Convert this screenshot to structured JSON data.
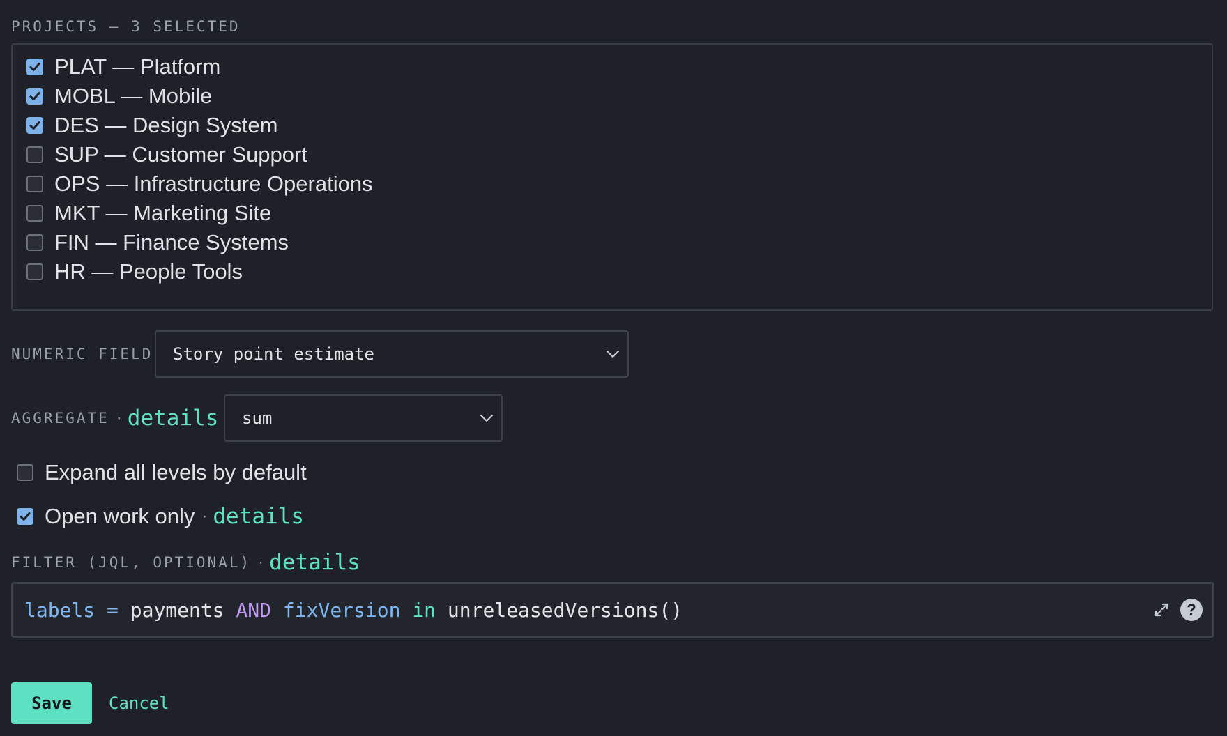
{
  "projects": {
    "label": "PROJECTS — 3 SELECTED",
    "items": [
      {
        "label": "PLAT — Platform",
        "checked": true
      },
      {
        "label": "MOBL — Mobile",
        "checked": true
      },
      {
        "label": "DES — Design System",
        "checked": true
      },
      {
        "label": "SUP — Customer Support",
        "checked": false
      },
      {
        "label": "OPS — Infrastructure Operations",
        "checked": false
      },
      {
        "label": "MKT — Marketing Site",
        "checked": false
      },
      {
        "label": "FIN — Finance Systems",
        "checked": false
      },
      {
        "label": "HR — People Tools",
        "checked": false
      }
    ]
  },
  "numeric_field": {
    "label": "NUMERIC FIELD",
    "selected": "Story point estimate"
  },
  "aggregate": {
    "label": "AGGREGATE",
    "separator": "·",
    "details_link": "details",
    "selected": "sum"
  },
  "expand_all": {
    "label": "Expand all levels by default",
    "checked": false
  },
  "open_work": {
    "label": "Open work only",
    "separator": "·",
    "details_link": "details",
    "checked": true
  },
  "filter": {
    "label": "FILTER (JQL, OPTIONAL)",
    "separator": "·",
    "details_link": "details",
    "tokens": {
      "t1": "labels",
      "t2": "=",
      "t3": "payments",
      "t4": "AND",
      "t5": "fixVersion",
      "t6": "in",
      "t7": "unreleasedVersions()"
    },
    "help_label": "?"
  },
  "actions": {
    "save_label": "Save",
    "cancel_label": "Cancel"
  },
  "colors": {
    "background": "#1e2127",
    "accent": "#5ee0c3",
    "checkbox_checked": "#7fb2e8",
    "jql_keyword": "#c29cf4",
    "jql_field": "#7eb6f2"
  }
}
